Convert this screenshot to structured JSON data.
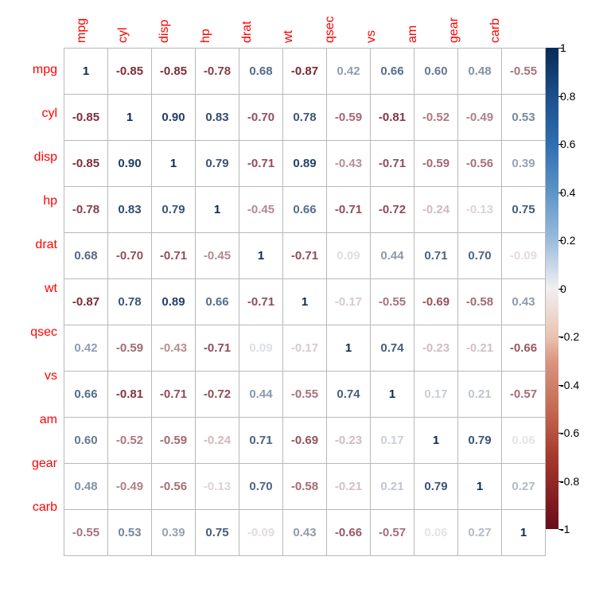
{
  "chart_data": {
    "type": "heatmap",
    "title": "",
    "variables": [
      "mpg",
      "cyl",
      "disp",
      "hp",
      "drat",
      "wt",
      "qsec",
      "vs",
      "am",
      "gear",
      "carb"
    ],
    "matrix": [
      [
        1.0,
        -0.85,
        -0.85,
        -0.78,
        0.68,
        -0.87,
        0.42,
        0.66,
        0.6,
        0.48,
        -0.55
      ],
      [
        -0.85,
        1.0,
        0.9,
        0.83,
        -0.7,
        0.78,
        -0.59,
        -0.81,
        -0.52,
        -0.49,
        0.53
      ],
      [
        -0.85,
        0.9,
        1.0,
        0.79,
        -0.71,
        0.89,
        -0.43,
        -0.71,
        -0.59,
        -0.56,
        0.39
      ],
      [
        -0.78,
        0.83,
        0.79,
        1.0,
        -0.45,
        0.66,
        -0.71,
        -0.72,
        -0.24,
        -0.13,
        0.75
      ],
      [
        0.68,
        -0.7,
        -0.71,
        -0.45,
        1.0,
        -0.71,
        0.09,
        0.44,
        0.71,
        0.7,
        -0.09
      ],
      [
        -0.87,
        0.78,
        0.89,
        0.66,
        -0.71,
        1.0,
        -0.17,
        -0.55,
        -0.69,
        -0.58,
        0.43
      ],
      [
        0.42,
        -0.59,
        -0.43,
        -0.71,
        0.09,
        -0.17,
        1.0,
        0.74,
        -0.23,
        -0.21,
        -0.66
      ],
      [
        0.66,
        -0.81,
        -0.71,
        -0.72,
        0.44,
        -0.55,
        0.74,
        1.0,
        0.17,
        0.21,
        -0.57
      ],
      [
        0.6,
        -0.52,
        -0.59,
        -0.24,
        0.71,
        -0.69,
        -0.23,
        0.17,
        1.0,
        0.79,
        0.06
      ],
      [
        0.48,
        -0.49,
        -0.56,
        -0.13,
        0.7,
        -0.58,
        -0.21,
        0.21,
        0.79,
        1.0,
        0.27
      ],
      [
        -0.55,
        0.53,
        0.39,
        0.75,
        -0.09,
        0.43,
        -0.66,
        -0.57,
        0.06,
        0.27,
        1.0
      ]
    ],
    "value_range": [
      -1,
      1
    ],
    "colorscale": "RdBu",
    "label_color": "red",
    "colorbar_ticks": [
      1,
      0.8,
      0.6,
      0.4,
      0.2,
      0,
      -0.2,
      -0.4,
      -0.6,
      -0.8,
      -1
    ]
  }
}
